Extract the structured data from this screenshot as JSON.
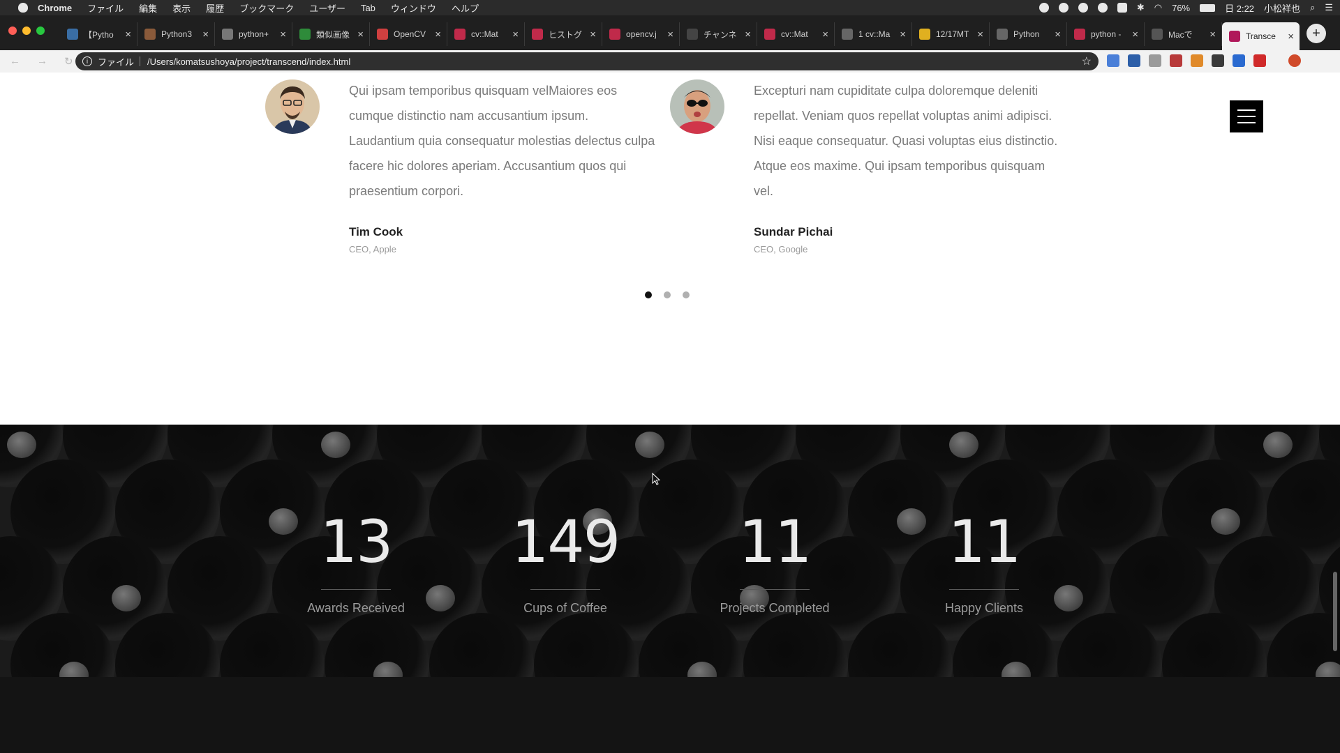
{
  "menubar": {
    "app": "Chrome",
    "items": [
      "ファイル",
      "編集",
      "表示",
      "履歴",
      "ブックマーク",
      "ユーザー",
      "Tab",
      "ウィンドウ",
      "ヘルプ"
    ],
    "battery": "76%",
    "clock": "日 2:22",
    "user": "小松祥也"
  },
  "tabs": [
    {
      "label": "【Pytho",
      "color": "#3a6ea5"
    },
    {
      "label": "Python3",
      "color": "#8a5a3a"
    },
    {
      "label": "python+",
      "color": "#777777"
    },
    {
      "label": "類似画像",
      "color": "#2e8b3a"
    },
    {
      "label": "OpenCV",
      "color": "#d04040"
    },
    {
      "label": "cv::Mat",
      "color": "#c02a4a"
    },
    {
      "label": "ヒストグ",
      "color": "#c02a4a"
    },
    {
      "label": "opencv.j",
      "color": "#c02a4a"
    },
    {
      "label": "チャンネ",
      "color": "#444444"
    },
    {
      "label": "cv::Mat",
      "color": "#c02a4a"
    },
    {
      "label": "1 cv::Ma",
      "color": "#666666"
    },
    {
      "label": "12/17MT",
      "color": "#e0b020"
    },
    {
      "label": "Python",
      "color": "#666666"
    },
    {
      "label": "python -",
      "color": "#c02a4a"
    },
    {
      "label": "Macで",
      "color": "#555555"
    },
    {
      "label": "Transce",
      "color": "#b0185a",
      "active": true
    }
  ],
  "toolbar": {
    "scheme": "ファイル",
    "url": "/Users/komatsushoya/project/transcend/index.html"
  },
  "testimonials": [
    {
      "quote": "Qui ipsam temporibus quisquam velMaiores eos cumque distinctio nam accusantium ipsum. Laudantium quia consequatur molestias delectus culpa facere hic dolores aperiam. Accusantium quos qui praesentium corpori.",
      "name": "Tim Cook",
      "role": "CEO, Apple"
    },
    {
      "quote": "Excepturi nam cupiditate culpa doloremque deleniti repellat. Veniam quos repellat voluptas animi adipisci. Nisi eaque consequatur. Quasi voluptas eius distinctio. Atque eos maxime. Qui ipsam temporibus quisquam vel.",
      "name": "Sundar Pichai",
      "role": "CEO, Google"
    }
  ],
  "carousel": {
    "active_index": 0,
    "count": 3
  },
  "stats": [
    {
      "number": "13",
      "label": "Awards Received"
    },
    {
      "number": "149",
      "label": "Cups of Coffee"
    },
    {
      "number": "11",
      "label": "Projects Completed"
    },
    {
      "number": "11",
      "label": "Happy Clients"
    }
  ]
}
